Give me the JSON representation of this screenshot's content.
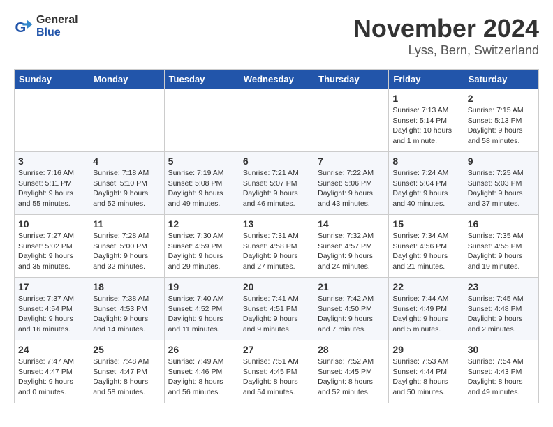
{
  "header": {
    "logo_line1": "General",
    "logo_line2": "Blue",
    "month": "November 2024",
    "location": "Lyss, Bern, Switzerland"
  },
  "weekdays": [
    "Sunday",
    "Monday",
    "Tuesday",
    "Wednesday",
    "Thursday",
    "Friday",
    "Saturday"
  ],
  "weeks": [
    [
      {
        "day": "",
        "info": ""
      },
      {
        "day": "",
        "info": ""
      },
      {
        "day": "",
        "info": ""
      },
      {
        "day": "",
        "info": ""
      },
      {
        "day": "",
        "info": ""
      },
      {
        "day": "1",
        "info": "Sunrise: 7:13 AM\nSunset: 5:14 PM\nDaylight: 10 hours and 1 minute."
      },
      {
        "day": "2",
        "info": "Sunrise: 7:15 AM\nSunset: 5:13 PM\nDaylight: 9 hours and 58 minutes."
      }
    ],
    [
      {
        "day": "3",
        "info": "Sunrise: 7:16 AM\nSunset: 5:11 PM\nDaylight: 9 hours and 55 minutes."
      },
      {
        "day": "4",
        "info": "Sunrise: 7:18 AM\nSunset: 5:10 PM\nDaylight: 9 hours and 52 minutes."
      },
      {
        "day": "5",
        "info": "Sunrise: 7:19 AM\nSunset: 5:08 PM\nDaylight: 9 hours and 49 minutes."
      },
      {
        "day": "6",
        "info": "Sunrise: 7:21 AM\nSunset: 5:07 PM\nDaylight: 9 hours and 46 minutes."
      },
      {
        "day": "7",
        "info": "Sunrise: 7:22 AM\nSunset: 5:06 PM\nDaylight: 9 hours and 43 minutes."
      },
      {
        "day": "8",
        "info": "Sunrise: 7:24 AM\nSunset: 5:04 PM\nDaylight: 9 hours and 40 minutes."
      },
      {
        "day": "9",
        "info": "Sunrise: 7:25 AM\nSunset: 5:03 PM\nDaylight: 9 hours and 37 minutes."
      }
    ],
    [
      {
        "day": "10",
        "info": "Sunrise: 7:27 AM\nSunset: 5:02 PM\nDaylight: 9 hours and 35 minutes."
      },
      {
        "day": "11",
        "info": "Sunrise: 7:28 AM\nSunset: 5:00 PM\nDaylight: 9 hours and 32 minutes."
      },
      {
        "day": "12",
        "info": "Sunrise: 7:30 AM\nSunset: 4:59 PM\nDaylight: 9 hours and 29 minutes."
      },
      {
        "day": "13",
        "info": "Sunrise: 7:31 AM\nSunset: 4:58 PM\nDaylight: 9 hours and 27 minutes."
      },
      {
        "day": "14",
        "info": "Sunrise: 7:32 AM\nSunset: 4:57 PM\nDaylight: 9 hours and 24 minutes."
      },
      {
        "day": "15",
        "info": "Sunrise: 7:34 AM\nSunset: 4:56 PM\nDaylight: 9 hours and 21 minutes."
      },
      {
        "day": "16",
        "info": "Sunrise: 7:35 AM\nSunset: 4:55 PM\nDaylight: 9 hours and 19 minutes."
      }
    ],
    [
      {
        "day": "17",
        "info": "Sunrise: 7:37 AM\nSunset: 4:54 PM\nDaylight: 9 hours and 16 minutes."
      },
      {
        "day": "18",
        "info": "Sunrise: 7:38 AM\nSunset: 4:53 PM\nDaylight: 9 hours and 14 minutes."
      },
      {
        "day": "19",
        "info": "Sunrise: 7:40 AM\nSunset: 4:52 PM\nDaylight: 9 hours and 11 minutes."
      },
      {
        "day": "20",
        "info": "Sunrise: 7:41 AM\nSunset: 4:51 PM\nDaylight: 9 hours and 9 minutes."
      },
      {
        "day": "21",
        "info": "Sunrise: 7:42 AM\nSunset: 4:50 PM\nDaylight: 9 hours and 7 minutes."
      },
      {
        "day": "22",
        "info": "Sunrise: 7:44 AM\nSunset: 4:49 PM\nDaylight: 9 hours and 5 minutes."
      },
      {
        "day": "23",
        "info": "Sunrise: 7:45 AM\nSunset: 4:48 PM\nDaylight: 9 hours and 2 minutes."
      }
    ],
    [
      {
        "day": "24",
        "info": "Sunrise: 7:47 AM\nSunset: 4:47 PM\nDaylight: 9 hours and 0 minutes."
      },
      {
        "day": "25",
        "info": "Sunrise: 7:48 AM\nSunset: 4:47 PM\nDaylight: 8 hours and 58 minutes."
      },
      {
        "day": "26",
        "info": "Sunrise: 7:49 AM\nSunset: 4:46 PM\nDaylight: 8 hours and 56 minutes."
      },
      {
        "day": "27",
        "info": "Sunrise: 7:51 AM\nSunset: 4:45 PM\nDaylight: 8 hours and 54 minutes."
      },
      {
        "day": "28",
        "info": "Sunrise: 7:52 AM\nSunset: 4:45 PM\nDaylight: 8 hours and 52 minutes."
      },
      {
        "day": "29",
        "info": "Sunrise: 7:53 AM\nSunset: 4:44 PM\nDaylight: 8 hours and 50 minutes."
      },
      {
        "day": "30",
        "info": "Sunrise: 7:54 AM\nSunset: 4:43 PM\nDaylight: 8 hours and 49 minutes."
      }
    ]
  ]
}
